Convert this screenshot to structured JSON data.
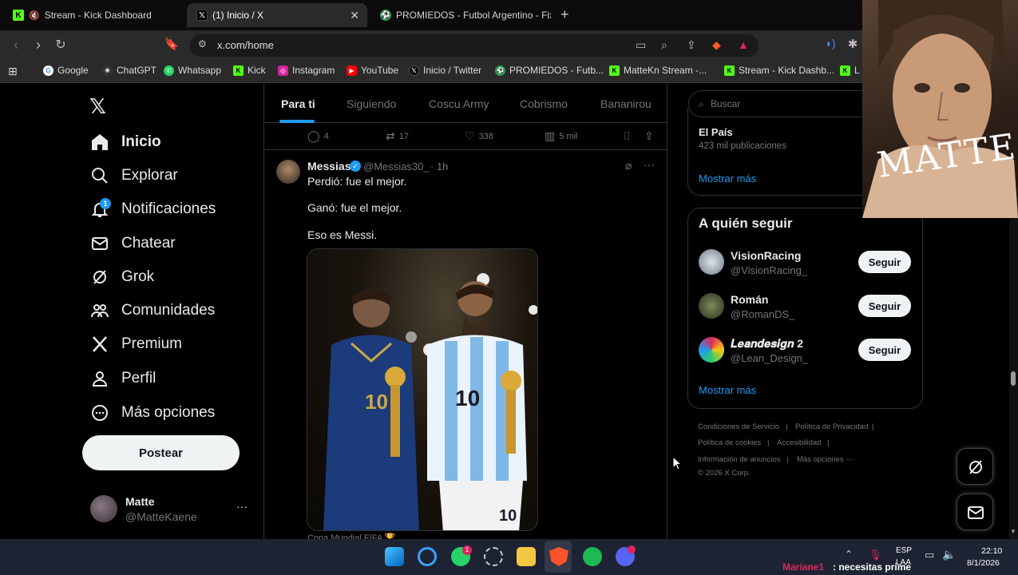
{
  "browser": {
    "tabs": [
      {
        "title": "Stream - Kick Dashboard",
        "icon": "kick-icon"
      },
      {
        "title": "(1) Inicio / X",
        "icon": "x-icon",
        "active": true
      },
      {
        "title": "PROMIEDOS - Futbol Argentino - Fixt",
        "icon": "promiedos-icon"
      }
    ],
    "url": "x.com/home",
    "bookmarks": [
      "Google",
      "ChatGPT",
      "Whatsapp",
      "Kick",
      "Instagram",
      "YouTube",
      "Inicio / Twitter",
      "PROMIEDOS - Futb...",
      "MatteKn Stream -...",
      "Stream - Kick Dashb...",
      "L"
    ]
  },
  "sidebar": {
    "items": [
      "Inicio",
      "Explorar",
      "Notificaciones",
      "Chatear",
      "Grok",
      "Comunidades",
      "Premium",
      "Perfil",
      "Más opciones"
    ],
    "notif_badge": "1",
    "post_label": "Postear",
    "account_name": "Matte",
    "account_handle": "@MatteKaene",
    "account_more": "···"
  },
  "feed": {
    "tabs": [
      "Para ti",
      "Siguiendo",
      "Coscu Army",
      "Cobrismo",
      "Bananirou"
    ],
    "prev_actions": {
      "replies": "4",
      "reposts": "17",
      "likes": "338",
      "views": "5 mil"
    },
    "post": {
      "author": "Messias",
      "handle": "@Messias30_",
      "time": "· 1h",
      "lines": [
        "Perdió: fue el mejor.",
        "Ganó: fue el mejor.",
        "Eso es Messi."
      ],
      "caption": "Copa Mundial FIFA 🏆",
      "more": "···"
    }
  },
  "right": {
    "search_placeholder": "Buscar",
    "trend_title": "El País",
    "trend_count": "423 mil publicaciones",
    "show_more": "Mostrar más",
    "who_to_follow": "A quién seguir",
    "suggestions": [
      {
        "name": "VisionRacing",
        "handle": "@VisionRacing_"
      },
      {
        "name": "Román",
        "handle": "@RomanDS_"
      },
      {
        "name": "𝑳𝒆𝒂𝒏𝒅𝒆𝒔𝒊𝒈𝒏 2",
        "handle": "@Lean_Design_"
      }
    ],
    "follow_label": "Seguir",
    "show_more_2": "Mostrar más",
    "footer": [
      "Condiciones de Servicio",
      "Política de Privacidad",
      "Política de cookies",
      "Accesibilidad",
      "Información de anuncios",
      "Más opciones ···",
      "© 2026 X Corp."
    ]
  },
  "overlay": {
    "webcam_text": "MATTE"
  },
  "taskbar": {
    "lang": "ESP",
    "lang2": "LAA",
    "time": "22:10",
    "date": "8/1/2026",
    "chat_user": "Mariane1",
    "chat_text": ": necesitas prime"
  },
  "colors": {
    "accent": "#1d9bf0",
    "kick": "#53fc18",
    "brave": "#fb542b"
  }
}
